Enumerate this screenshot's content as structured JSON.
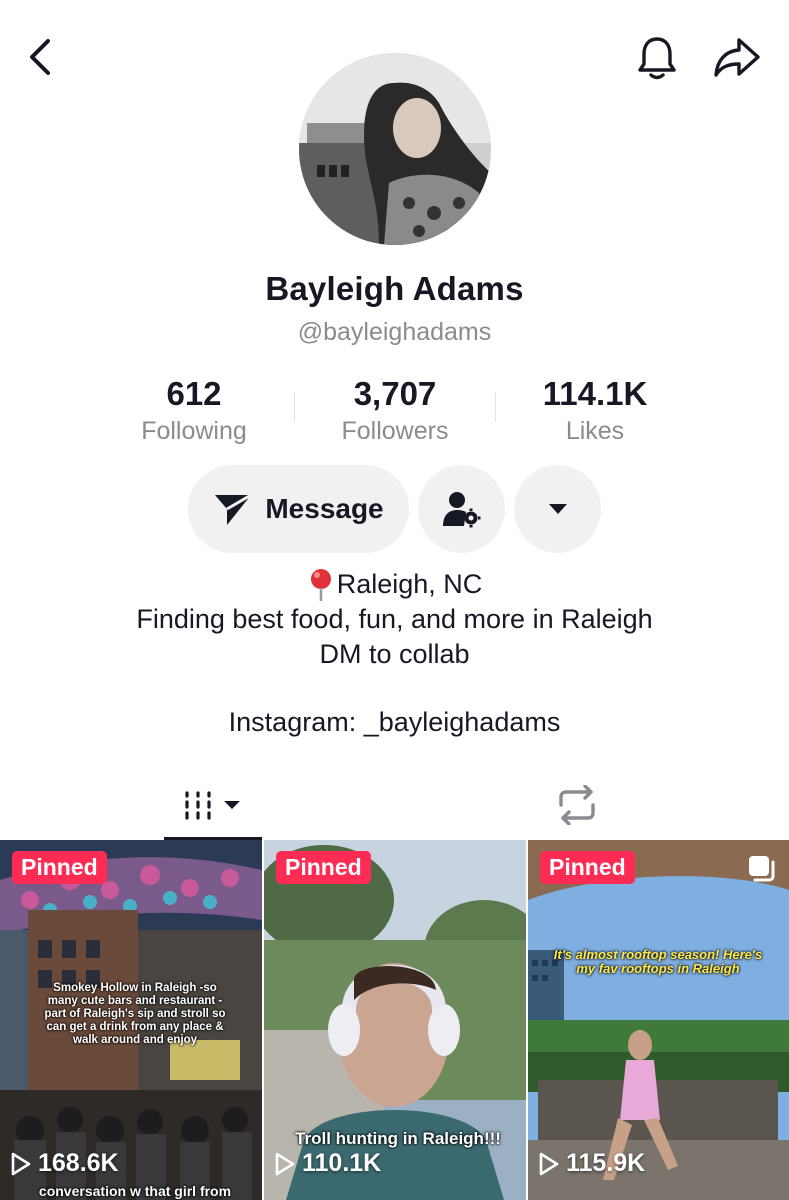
{
  "header": {
    "back_icon": "chevron-left-icon",
    "notification_icon": "bell-icon",
    "share_icon": "share-arrow-icon"
  },
  "profile": {
    "display_name": "Bayleigh Adams",
    "username": "@bayleighadams"
  },
  "stats": [
    {
      "value": "612",
      "label": "Following"
    },
    {
      "value": "3,707",
      "label": "Followers"
    },
    {
      "value": "114.1K",
      "label": "Likes"
    }
  ],
  "actions": {
    "message_label": "Message",
    "message_icon": "send-icon",
    "friends_icon": "person-settings-icon",
    "more_icon": "caret-down-icon"
  },
  "bio": {
    "location": "Raleigh, NC",
    "line1": "Finding best food, fun, and more in Raleigh",
    "line2": "DM to collab",
    "line3": "Instagram: _bayleighadams"
  },
  "tabs": [
    {
      "icon": "videos-grid-icon",
      "active": true
    },
    {
      "icon": "repost-icon",
      "active": false
    }
  ],
  "videos": [
    {
      "badge": "Pinned",
      "views": "168.6K",
      "caption": "Smokey Hollow in Raleigh\n-so many cute bars and restaurant\n-part of Raleigh's sip and stroll so can get a drink from any place & walk around and enjoy",
      "bottom_caption": "conversation w that girl from"
    },
    {
      "badge": "Pinned",
      "views": "110.1K",
      "caption": "Troll hunting in Raleigh!!!"
    },
    {
      "badge": "Pinned",
      "views": "115.9K",
      "caption": "It's almost rooftop season! Here's my fav rooftops in Raleigh"
    }
  ],
  "colors": {
    "accent": "#fe2c55",
    "text": "#161823",
    "muted": "#8a8b91",
    "button_bg": "#f1f1f2"
  }
}
